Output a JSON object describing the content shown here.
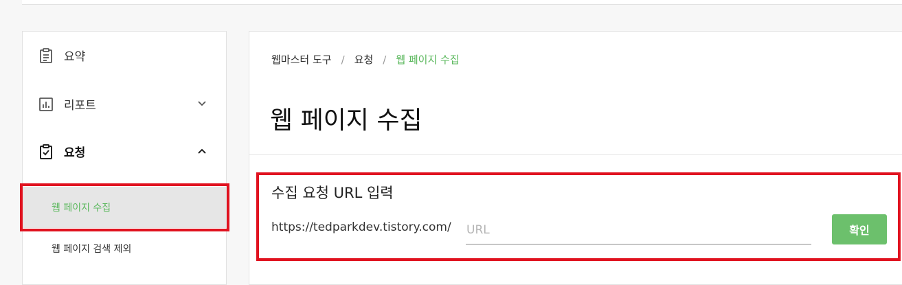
{
  "sidebar": {
    "items": [
      {
        "label": "요약",
        "icon": "clipboard-list-icon"
      },
      {
        "label": "리포트",
        "icon": "bar-chart-icon",
        "chevron": "chevron-down-icon"
      },
      {
        "label": "요청",
        "icon": "clipboard-check-icon",
        "chevron": "chevron-up-icon"
      }
    ],
    "sub_items": [
      {
        "label": "웹 페이지 수집",
        "active": true
      },
      {
        "label": "웹 페이지 검색 제외",
        "active": false
      }
    ]
  },
  "breadcrumb": [
    "웹마스터 도구",
    "요청",
    "웹 페이지 수집"
  ],
  "breadcrumb_separator": "/",
  "page_title": "웹 페이지 수집",
  "form": {
    "section_title": "수집 요청 URL 입력",
    "url_prefix": "https://tedparkdev.tistory.com/",
    "url_input_value": "",
    "url_input_placeholder": "URL",
    "confirm_label": "확인"
  },
  "colors": {
    "accent_green": "#5bb85d",
    "button_green": "#6cc06c",
    "highlight_red": "#e0121f"
  }
}
